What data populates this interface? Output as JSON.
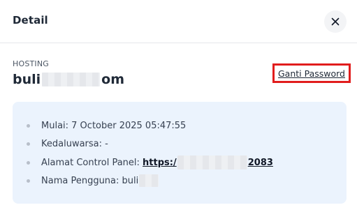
{
  "modal": {
    "title": "Detail",
    "close_icon": "close-icon"
  },
  "hosting": {
    "label": "HOSTING",
    "domain_prefix": "buli",
    "domain_suffix": "om",
    "change_password_label": "Ganti Password"
  },
  "details": {
    "start": "Mulai: 7 October 2025 05:47:55",
    "expiry": "Kedaluwarsa: -",
    "panel_label": "Alamat Control Panel: ",
    "panel_url_prefix": "https:/",
    "panel_url_suffix": "2083",
    "username_label": "Nama Pengguna: buli"
  },
  "colors": {
    "info_background": "#ebf3fd",
    "highlight_border": "#e11d1d"
  }
}
